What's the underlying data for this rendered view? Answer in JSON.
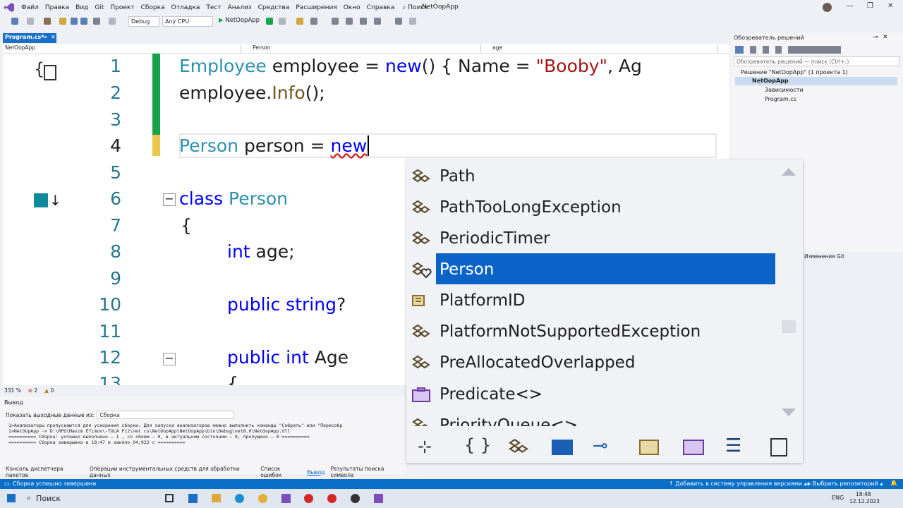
{
  "menubar": {
    "items": [
      "Файл",
      "Правка",
      "Вид",
      "Git",
      "Проект",
      "Сборка",
      "Отладка",
      "Тест",
      "Анализ",
      "Средства",
      "Расширения",
      "Окно",
      "Справка"
    ],
    "search": "Поиск",
    "solution": "NetOopApp"
  },
  "toolbar": {
    "config": "Debug",
    "platform": "Any CPU",
    "run_target": "NetOopApp"
  },
  "tab": {
    "label": "Program.cs*"
  },
  "navbar": {
    "project": "NetOopApp",
    "type": "Person",
    "member": "age"
  },
  "editor": {
    "zoom": "331 %",
    "errors": "2",
    "warnings": "0",
    "lines": [
      {
        "n": "1"
      },
      {
        "n": "2"
      },
      {
        "n": "3"
      },
      {
        "n": "4"
      },
      {
        "n": "5"
      },
      {
        "n": "6"
      },
      {
        "n": "7"
      },
      {
        "n": "8"
      },
      {
        "n": "9"
      },
      {
        "n": "10"
      },
      {
        "n": "11"
      },
      {
        "n": "12"
      },
      {
        "n": "13"
      }
    ],
    "code": {
      "l1_a": "Employee",
      "l1_b": " employee = ",
      "l1_c": "new",
      "l1_d": "() { Name = ",
      "l1_e": "\"Booby\"",
      "l1_f": ", Ag",
      "l2_a": "employee.",
      "l2_b": "Info",
      "l2_c": "();",
      "l4_a": "Person",
      "l4_b": " person = ",
      "l4_c": "new",
      "l6_a": "class ",
      "l6_b": "Person",
      "l7": "{",
      "l8_a": "int",
      "l8_b": " age;",
      "l10_a": "public string",
      "l10_b": "?",
      "l12_a": "public int",
      "l12_b": " Age",
      "l13": "{"
    }
  },
  "completion": {
    "items": [
      "Path",
      "PathTooLongException",
      "PeriodicTimer",
      "Person",
      "PlatformID",
      "PlatformNotSupportedException",
      "PreAllocatedOverlapped",
      "Predicate<>",
      "PriorityQueue<>"
    ],
    "selected_index": 3
  },
  "solution_explorer": {
    "title": "Обозреватель решений",
    "search_placeholder": "Обозреватель решений — поиск (Ctrl+;)",
    "solution": "Решение \"NetOopApp\" (1 проекта 1)",
    "project": "NetOopApp",
    "dependencies": "Зависимости",
    "file": "Program.cs",
    "git_changes": "Изменения Git"
  },
  "output": {
    "title": "Вывод",
    "show_from_label": "Показать выходные данные из:",
    "show_from_value": "Сборка",
    "lines": [
      "1>Анализаторы пропускаются для ускорения сборки. Для запуска анализаторов можно выполнить команды \"Собрать\" или \"Пересобр",
      "1>NetOopApp -> D:\\RPO\\Maxim Efimov\\-TULA P12\\net cs\\NetOopApp\\NetOopApp\\bin\\Debug\\net8.0\\NetOopApp.dll",
      "========== Сборка: успешно выполнено — 1 , со сбоем — 0, в актуальном состоянии — 0, пропущено — 0 ==========",
      "========== Сборка завершено в 18:47 и заняло 04,922 с =========="
    ],
    "tabs": [
      "Консоль диспетчера пакетов",
      "Операции инструментальных средств для обработки данных",
      "Список ошибок",
      "Вывод",
      "Результаты поиска символа"
    ]
  },
  "status": {
    "left": "Сборка успешно завершена",
    "vcs": "Добавить в систему управления версиями",
    "repo": "Выбрать репозиторий"
  },
  "taskbar": {
    "search": "Поиск",
    "lang": "ENG",
    "time": "18:48",
    "date": "12.12.2023"
  },
  "colors": {
    "accent": "#0a64c8",
    "keyword": "#0000ff",
    "type": "#2b91af",
    "string": "#a31515",
    "status": "#0a6fc9"
  }
}
